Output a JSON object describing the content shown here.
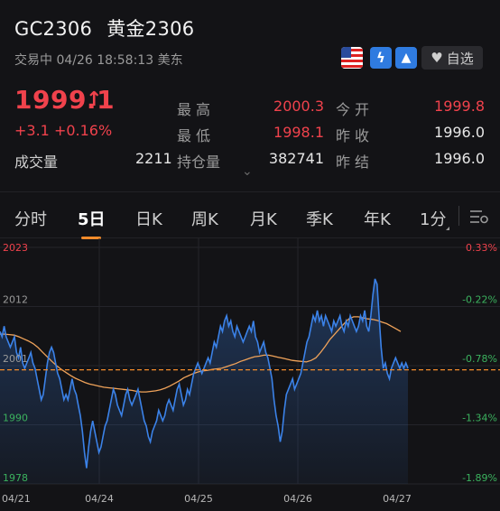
{
  "header": {
    "symbol": "GC2306",
    "name": "黄金2306",
    "status": "交易中 04/26 18:58:13 美东",
    "watch_label": "自选",
    "icons": [
      "us-flag-icon",
      "bolt-icon",
      "mountain-icon",
      "heart-icon"
    ]
  },
  "quote": {
    "price": "1999.1",
    "change": "+3.1  +0.16%",
    "volume_label": "成交量",
    "volume": "2211",
    "stats": [
      {
        "label": "最高",
        "value": "2000.3",
        "color": "red"
      },
      {
        "label": "今开",
        "value": "1999.8",
        "color": "red"
      },
      {
        "label": "最低",
        "value": "1998.1",
        "color": "red"
      },
      {
        "label": "昨收",
        "value": "1996.0",
        "color": "white"
      },
      {
        "label": "持仓量",
        "value": "382741",
        "color": "white"
      },
      {
        "label": "昨结",
        "value": "1996.0",
        "color": "white"
      }
    ]
  },
  "tabs": [
    "分时",
    "5日",
    "日K",
    "周K",
    "月K",
    "季K",
    "年K",
    "1分"
  ],
  "active_tab": "5日",
  "colors": {
    "accent": "#f38b2b",
    "up": "#f0424c",
    "down": "#3bb25e",
    "line": "#3b82e8",
    "avg": "#f0a35a"
  },
  "chart_data": {
    "type": "line",
    "y_ticks": [
      "2023",
      "2012",
      "2001",
      "1990",
      "1978"
    ],
    "y_range": [
      1978,
      2023
    ],
    "pct_ticks": [
      "0.33%",
      "-0.22%",
      "-0.78%",
      "-1.34%",
      "-1.89%"
    ],
    "x_ticks": [
      "04/21",
      "04/24",
      "04/25",
      "04/26",
      "04/27"
    ],
    "reference": 1999.7,
    "series": [
      {
        "values": [
          2007,
          2006,
          2008,
          2006,
          2005,
          2004,
          2005,
          2006,
          2003,
          2002,
          2004,
          2001,
          2000,
          2001,
          2002,
          2003,
          2001,
          2000,
          1998,
          1996,
          1994,
          1995,
          1998,
          2001,
          2003,
          2004,
          2003,
          2001,
          1999,
          1998,
          1996,
          1994,
          1995,
          1994,
          1996,
          1998,
          1996,
          1995,
          1993,
          1991,
          1988,
          1984,
          1981,
          1985,
          1988,
          1990,
          1988,
          1986,
          1984,
          1985,
          1987,
          1989,
          1990,
          1992,
          1994,
          1996,
          1995,
          1993,
          1992,
          1991,
          1993,
          1995,
          1996,
          1994,
          1993,
          1994,
          1995,
          1996,
          1994,
          1992,
          1990,
          1989,
          1987,
          1986,
          1988,
          1989,
          1990,
          1992,
          1991,
          1990,
          1991,
          1993,
          1994,
          1993,
          1992,
          1994,
          1996,
          1997,
          1995,
          1993,
          1994,
          1996,
          1995,
          1997,
          1999,
          2000,
          2001,
          2000,
          1999,
          2000,
          2001,
          2002,
          2001,
          2003,
          2005,
          2004,
          2006,
          2008,
          2007,
          2009,
          2010,
          2008,
          2009,
          2007,
          2006,
          2008,
          2007,
          2006,
          2005,
          2006,
          2007,
          2008,
          2007,
          2009,
          2006,
          2005,
          2003,
          2004,
          2005,
          2003,
          2002,
          2000,
          1998,
          1994,
          1991,
          1989,
          1986,
          1988,
          1992,
          1995,
          1996,
          1997,
          1998,
          1996,
          1997,
          1998,
          1999,
          2001,
          2003,
          2005,
          2006,
          2008,
          2010,
          2009,
          2011,
          2009,
          2010,
          2008,
          2010,
          2009,
          2008,
          2007,
          2009,
          2008,
          2009,
          2010,
          2008,
          2007,
          2009,
          2008,
          2010,
          2009,
          2008,
          2007,
          2008,
          2010,
          2009,
          2011,
          2008,
          2007,
          2010,
          2014,
          2017,
          2016,
          2010,
          2004,
          2000,
          2001,
          1999,
          1998,
          2000,
          2001,
          2002,
          2001,
          2000,
          2001,
          2000,
          2001,
          2000
        ]
      },
      {
        "values": [
          2006.5,
          2006.5,
          2006.4,
          2006.3,
          2006.0,
          2005.6,
          2005.2,
          2004.7,
          2004.0,
          2003.1,
          2002.2,
          2001.3,
          2000.5,
          1999.8,
          1999.2,
          1998.6,
          1998.1,
          1997.7,
          1997.3,
          1997.0,
          1996.8,
          1996.6,
          1996.4,
          1996.3,
          1996.2,
          1996.1,
          1996.0,
          1995.9,
          1995.8,
          1995.6,
          1995.5,
          1995.5,
          1995.6,
          1995.7,
          1995.9,
          1996.2,
          1996.6,
          1997.1,
          1997.6,
          1998.2,
          1998.6,
          1999.0,
          1999.3,
          1999.5,
          1999.6,
          1999.8,
          1999.9,
          2000.0,
          2000.3,
          2000.6,
          2000.9,
          2001.3,
          2001.6,
          2001.9,
          2002.2,
          2002.3,
          2002.5,
          2002.5,
          2002.3,
          2002.1,
          2001.9,
          2001.7,
          2001.5,
          2001.4,
          2001.3,
          2001.2,
          2001.5,
          2002.0,
          2003.0,
          2004.2,
          2005.5,
          2006.5,
          2007.5,
          2008.5,
          2009.4,
          2009.8,
          2009.8,
          2009.6,
          2009.4,
          2009.3,
          2009.1,
          2008.8,
          2008.5,
          2008.0,
          2007.5,
          2007.0
        ]
      }
    ]
  }
}
